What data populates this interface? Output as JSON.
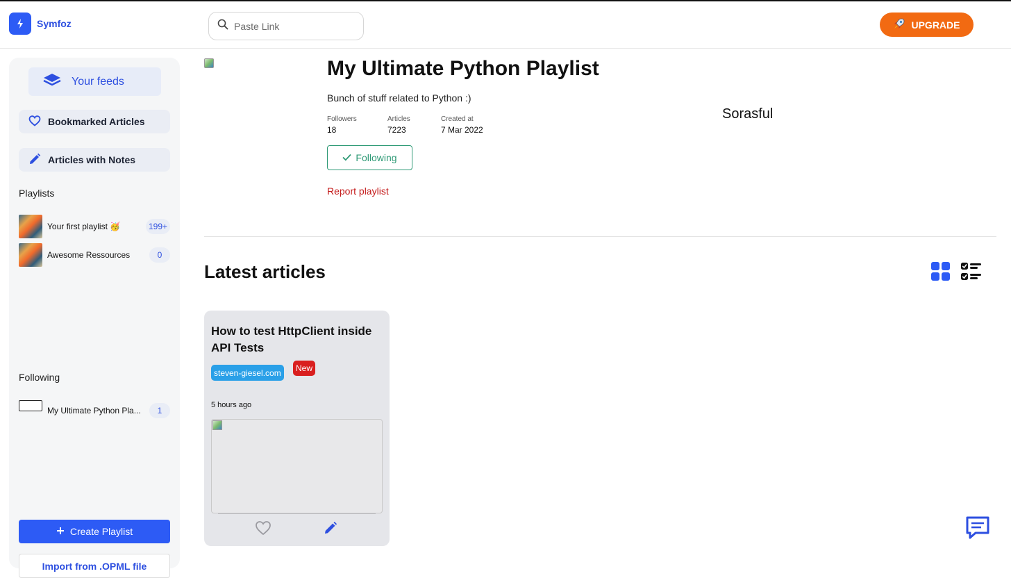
{
  "header": {
    "app_name": "Symfoz",
    "search_placeholder": "Paste Link",
    "upgrade_label": "UPGRADE"
  },
  "sidebar": {
    "feeds_label": "Your feeds",
    "bookmarked_label": "Bookmarked Articles",
    "notes_label": "Articles with Notes",
    "playlists_title": "Playlists",
    "playlists": [
      {
        "name": "Your first playlist 🥳",
        "count": "199+"
      },
      {
        "name": "Awesome Ressources",
        "count": "0"
      }
    ],
    "following_title": "Following",
    "following": [
      {
        "name": "My Ultimate Python Pla...",
        "count": "1"
      }
    ],
    "create_label": "Create Playlist",
    "import_label": "Import from .OPML file"
  },
  "playlist": {
    "title": "My Ultimate Python Playlist",
    "description": "Bunch of stuff related to Python :)",
    "stats": [
      {
        "label": "Followers",
        "value": "18"
      },
      {
        "label": "Articles",
        "value": "7223"
      },
      {
        "label": "Created at",
        "value": "7 Mar 2022"
      }
    ],
    "following_label": "Following",
    "report_label": "Report playlist",
    "owner": "Sorasful"
  },
  "latest": {
    "title": "Latest articles",
    "articles": [
      {
        "title": "How to test HttpClient inside API Tests",
        "source": "steven-giesel.com",
        "badge": "New",
        "time": "5 hours ago"
      }
    ]
  },
  "colors": {
    "accent": "#2d5bf5",
    "upgrade": "#f26a12",
    "following": "#2f9a76",
    "report": "#c41a1a",
    "new_badge": "#d91f1f",
    "source_tag": "#2aa0e8"
  },
  "icons": [
    "bolt-icon",
    "search-icon",
    "rocket-icon",
    "layers-icon",
    "heart-icon",
    "pencil-icon",
    "plus-icon",
    "check-icon",
    "grid-view-icon",
    "list-view-icon",
    "chat-icon"
  ]
}
